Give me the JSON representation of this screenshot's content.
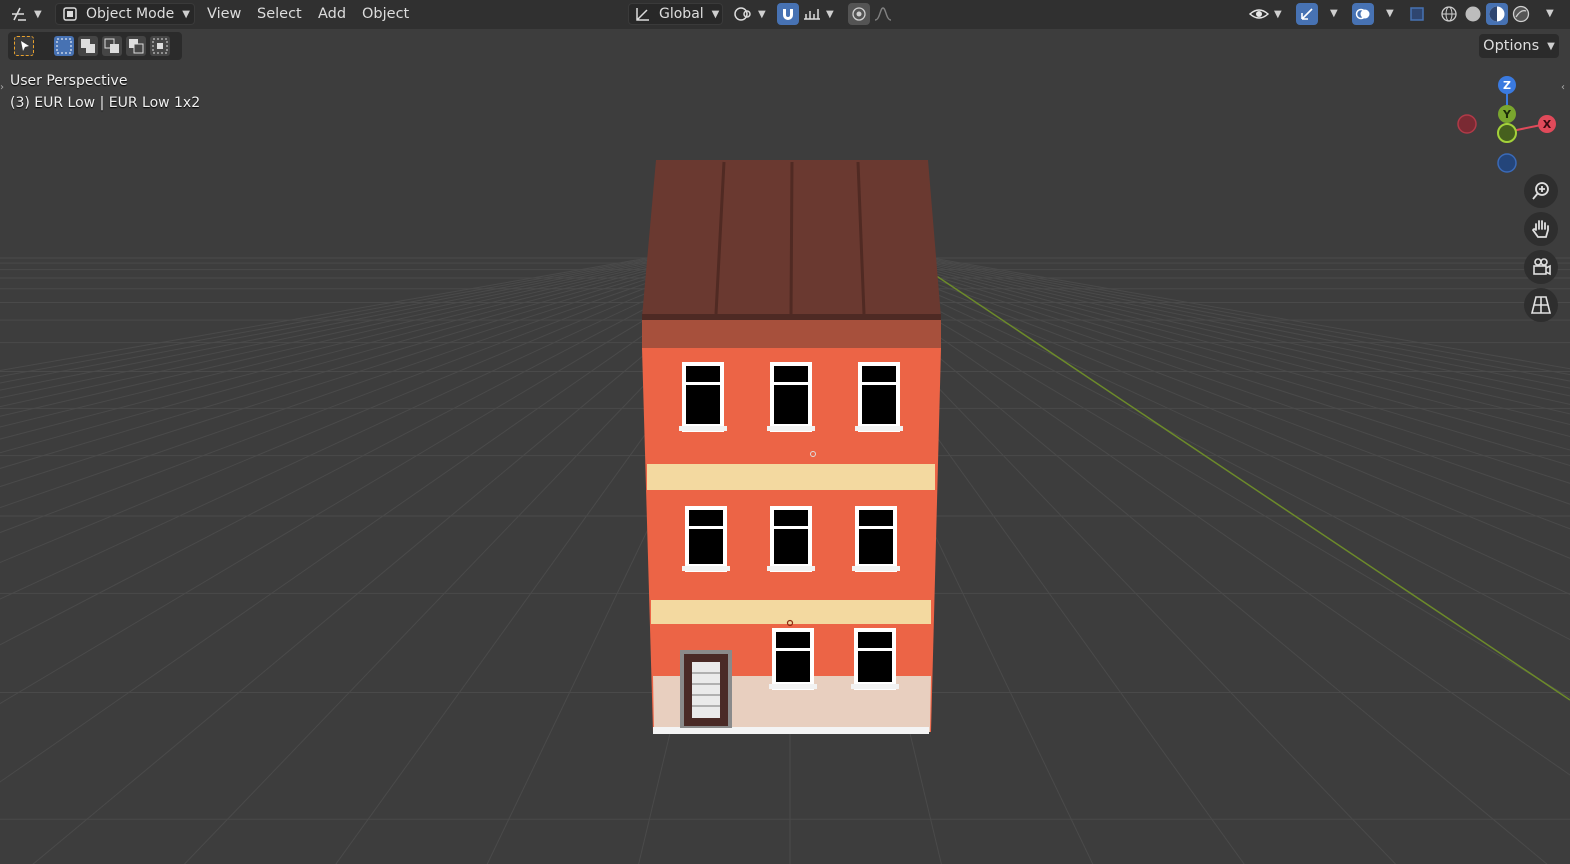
{
  "header": {
    "editor_type_icon": "transform-gizmo-icon",
    "mode_label": "Object Mode",
    "menus": [
      "View",
      "Select",
      "Add",
      "Object"
    ],
    "transform_orientation": "Global",
    "options_label": "Options"
  },
  "viewport": {
    "view_name": "User Perspective",
    "object_info": "(3) EUR Low | EUR Low 1x2"
  },
  "gizmo": {
    "z_label": "Z",
    "y_label": "Y",
    "x_label": "X",
    "colors": {
      "x": "#e04a5a",
      "y": "#7aa62e",
      "z": "#3a7ae0"
    }
  },
  "nav_icons": [
    "zoom-icon",
    "hand-pan-icon",
    "camera-icon",
    "ortho-grid-icon"
  ],
  "colors": {
    "background": "#3d3d3d",
    "header": "#303030",
    "accent": "#4772b3",
    "building_wall": "#ec6446",
    "roof": "#6a3930",
    "trim": "#f3d9a0"
  }
}
